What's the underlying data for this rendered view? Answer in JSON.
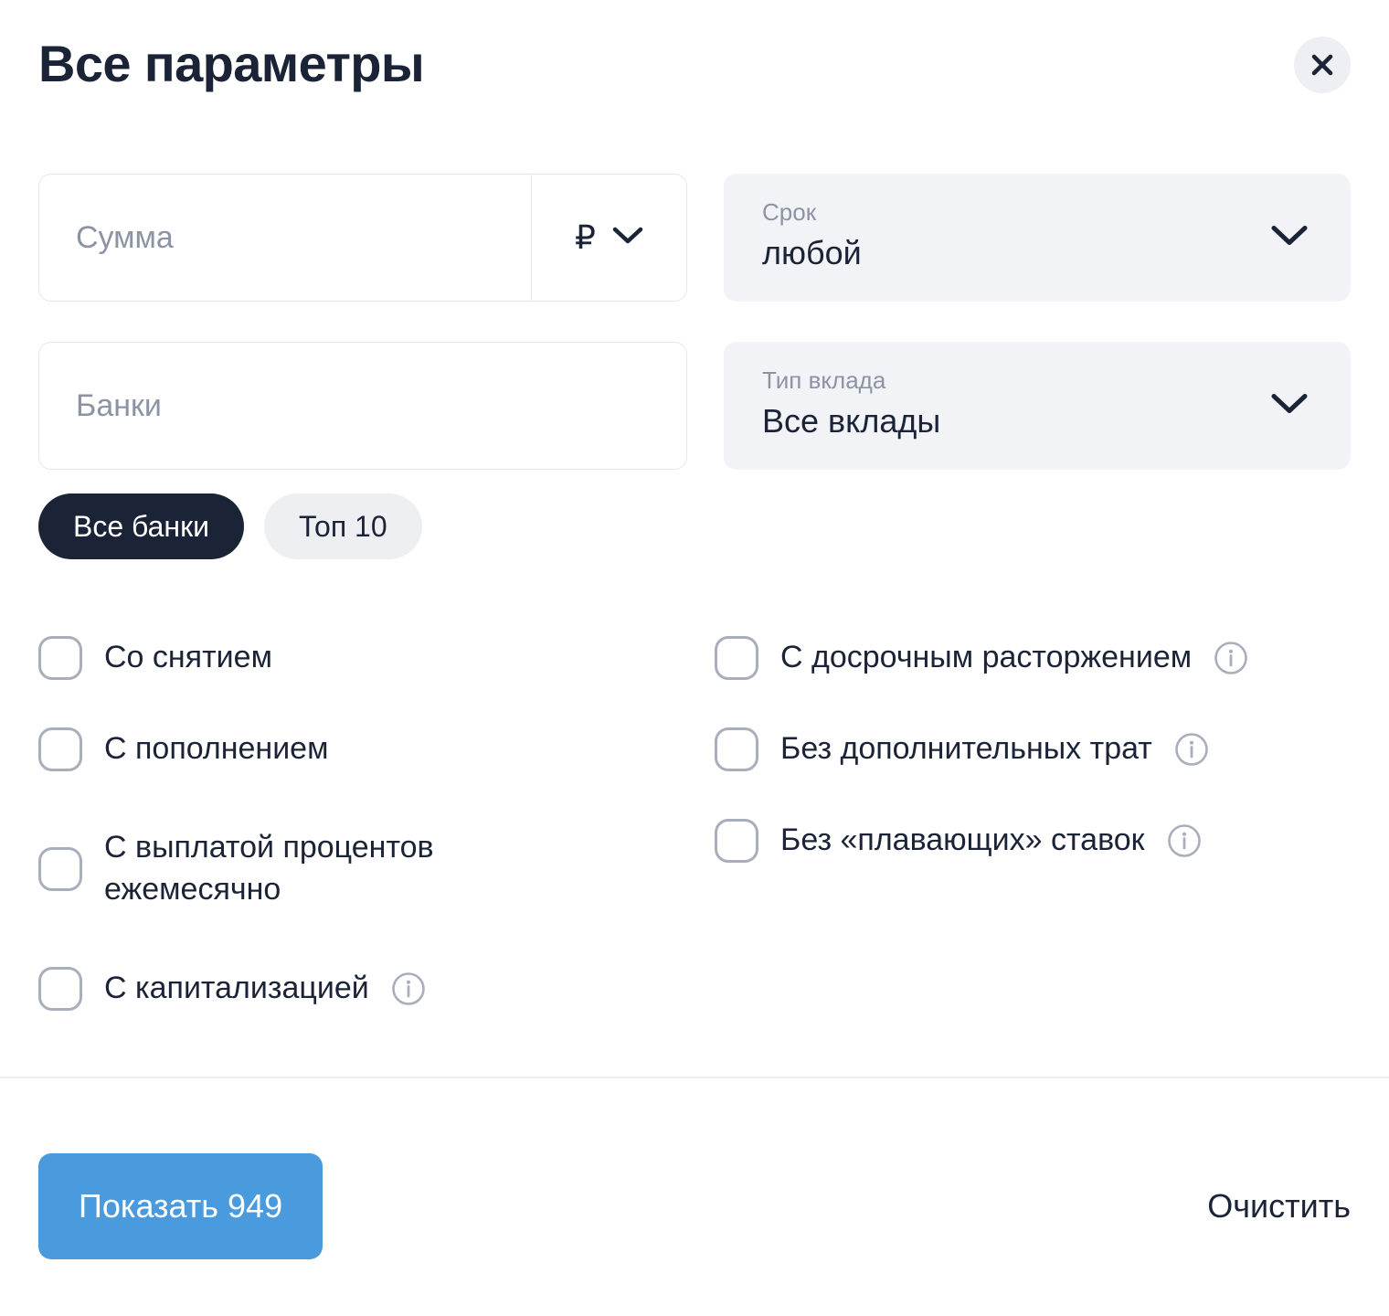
{
  "header": {
    "title": "Все параметры",
    "close_icon": "close-icon"
  },
  "filters": {
    "amount": {
      "placeholder": "Сумма",
      "value": "",
      "currency_symbol": "₽",
      "currency_chevron_icon": "chevron-down-icon"
    },
    "term": {
      "label": "Срок",
      "value": "любой",
      "chevron_icon": "chevron-down-icon"
    },
    "banks": {
      "placeholder": "Банки",
      "value": ""
    },
    "deposit_type": {
      "label": "Тип вклада",
      "value": "Все вклады",
      "chevron_icon": "chevron-down-icon"
    },
    "bank_scope": {
      "options": [
        {
          "label": "Все банки",
          "selected": true
        },
        {
          "label": "Топ 10",
          "selected": false
        }
      ]
    }
  },
  "checkboxes": {
    "left": [
      {
        "label": "Со снятием",
        "checked": false,
        "info": false
      },
      {
        "label": "С пополнением",
        "checked": false,
        "info": false
      },
      {
        "label": "С выплатой процентов ежемесячно",
        "checked": false,
        "info": false
      },
      {
        "label": "С капитализацией",
        "checked": false,
        "info": true
      }
    ],
    "right": [
      {
        "label": "С досрочным расторжением",
        "checked": false,
        "info": true
      },
      {
        "label": "Без дополнительных трат",
        "checked": false,
        "info": true
      },
      {
        "label": "Без «плавающих» ставок",
        "checked": false,
        "info": true
      }
    ]
  },
  "footer": {
    "show_label": "Показать 949",
    "clear_label": "Очистить"
  },
  "colors": {
    "accent": "#4a9bdd",
    "dark": "#1b2336",
    "muted": "#8b93a5",
    "field_bg": "#f2f3f7",
    "border": "#e4e7ec",
    "checkbox_border": "#a8aebb"
  }
}
